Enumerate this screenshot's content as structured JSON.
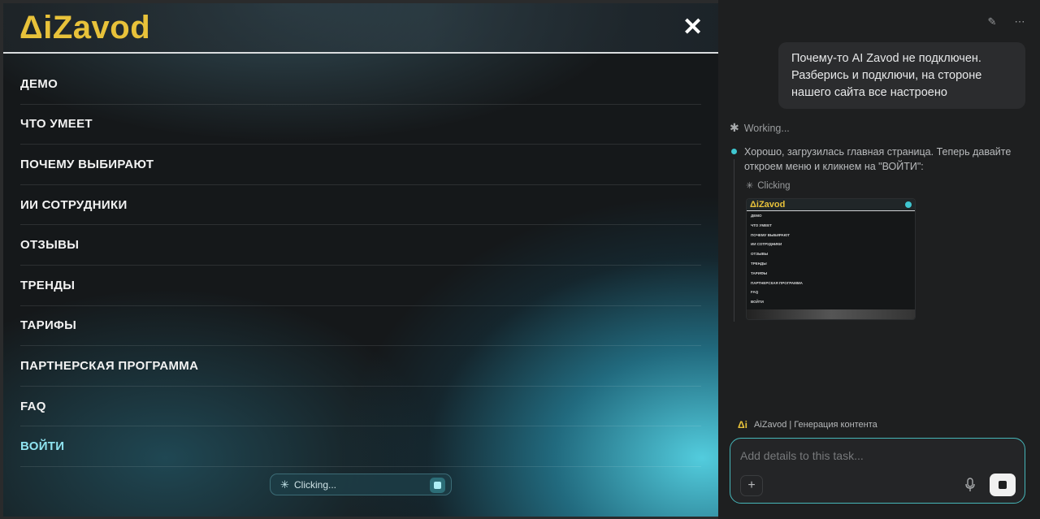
{
  "site": {
    "logo": "ΔiZavod",
    "close_label": "✕",
    "menu": [
      {
        "label": "ДЕМО"
      },
      {
        "label": "ЧТО УМЕЕТ"
      },
      {
        "label": "ПОЧЕМУ ВЫБИРАЮТ"
      },
      {
        "label": "ИИ СОТРУДНИКИ"
      },
      {
        "label": "ОТЗЫВЫ"
      },
      {
        "label": "ТРЕНДЫ"
      },
      {
        "label": "ТАРИФЫ"
      },
      {
        "label": "ПАРТНЕРСКАЯ ПРОГРАММА"
      },
      {
        "label": "FAQ"
      },
      {
        "label": "ВОЙТИ"
      }
    ],
    "status_text": "Clicking..."
  },
  "panel": {
    "user_message": "Почему-то AI Zavod не подключен. Разберись и подключи, на стороне нашего сайта все настроено",
    "working_label": "Working...",
    "step_text": "Хорошо, загрузилась главная страница. Теперь давайте откроем меню и кликнем на \"ВОЙТИ\":",
    "clicking_label": "Clicking",
    "thumbnail": {
      "logo": "ΔiZavod",
      "items": [
        "ДЕМО",
        "ЧТО УМЕЕТ",
        "ПОЧЕМУ ВЫБИРАЮТ",
        "ИИ СОТРУДНИКИ",
        "ОТЗЫВЫ",
        "ТРЕНДЫ",
        "ТАРИФЫ",
        "ПАРТНЕРСКАЯ ПРОГРАММА",
        "FAQ",
        "ВОЙТИ"
      ]
    },
    "context": {
      "logo": "Δi",
      "label": "AiZavod | Генерация контента"
    },
    "composer": {
      "placeholder": "Add details to this task...",
      "plus_label": "+"
    }
  },
  "colors": {
    "brand_yellow": "#e8c23a",
    "accent_cyan": "#3fc6d0"
  },
  "icons": [
    "close-icon",
    "edit-icon",
    "more-icon",
    "bug-icon",
    "sparkle-icon",
    "plus-icon",
    "mic-icon",
    "stop-icon"
  ]
}
